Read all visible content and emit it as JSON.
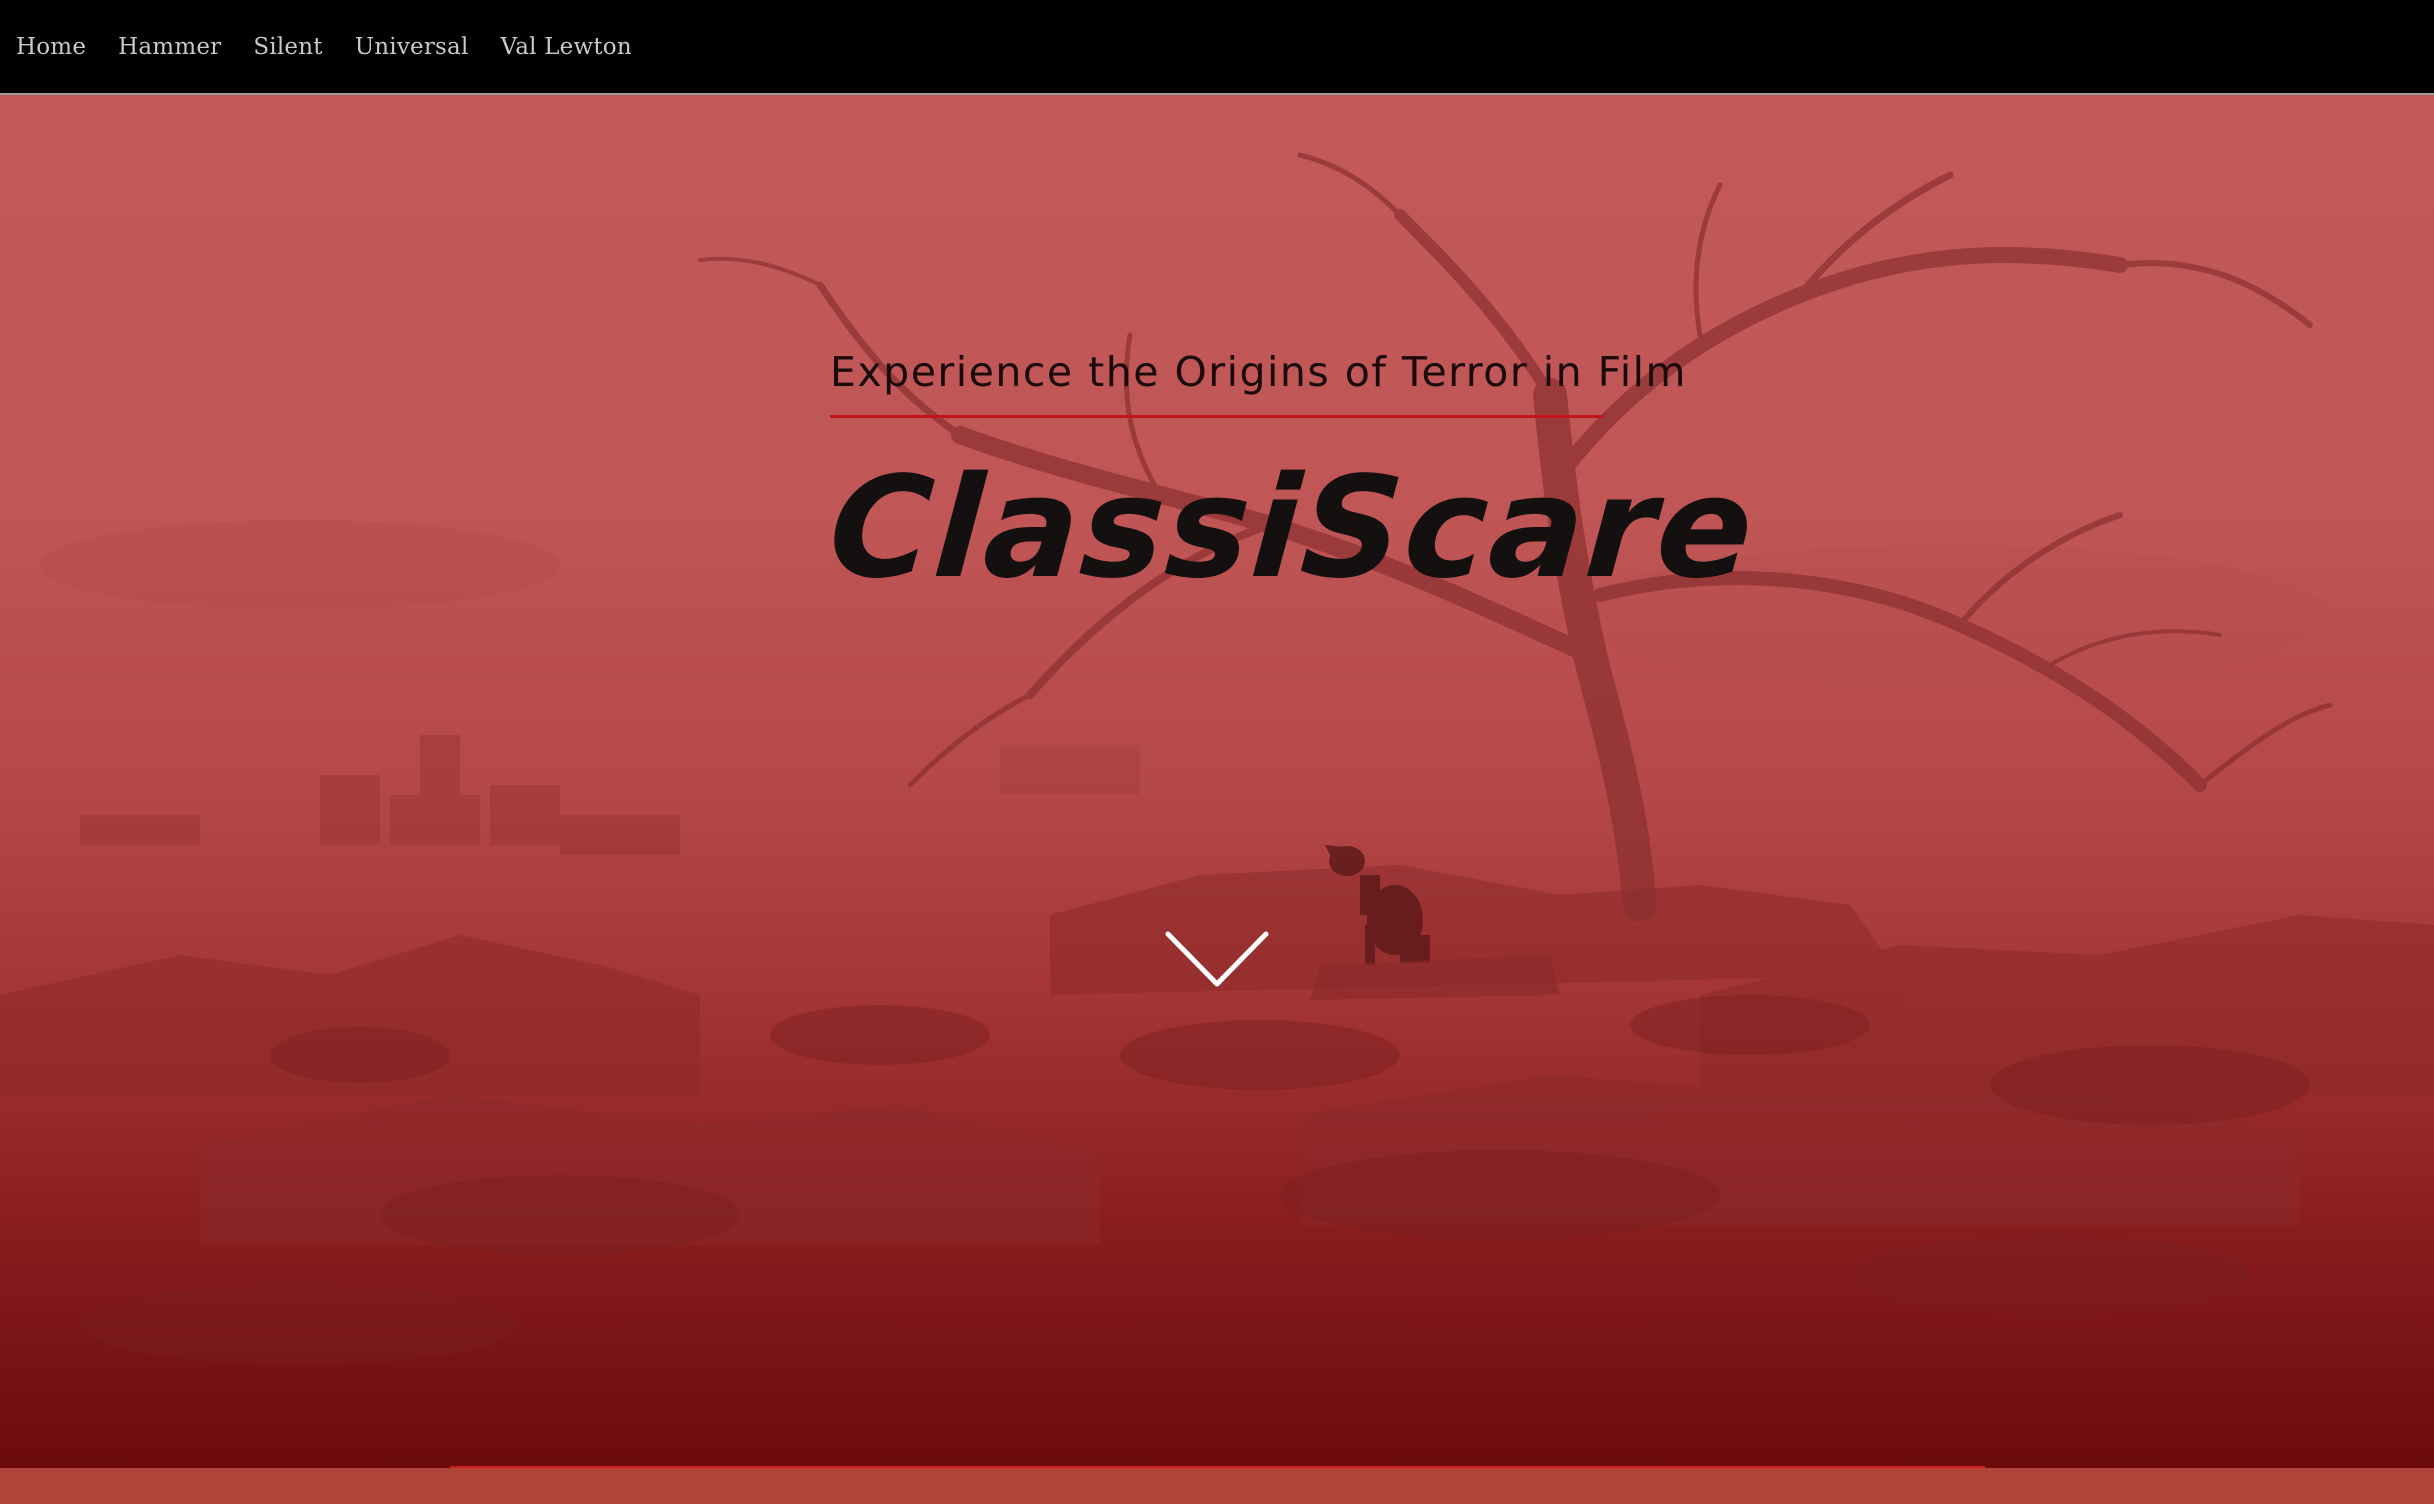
{
  "nav": {
    "items": [
      {
        "label": "Home"
      },
      {
        "label": "Hammer"
      },
      {
        "label": "Silent"
      },
      {
        "label": "Universal"
      },
      {
        "label": "Val Lewton"
      }
    ]
  },
  "hero": {
    "subtitle": "Experience the Origins of Terror in Film",
    "title": "ClassiScare",
    "scroll_icon": "chevron-down-icon",
    "background_image": "foggy-tree-with-dog-silhouette"
  },
  "colors": {
    "nav_bg": "#000000",
    "nav_text": "#c9c9c9",
    "hero_top": "#c25959",
    "hero_bottom": "#6b0a0d",
    "accent_red": "#c4141a",
    "title_text": "#151010",
    "footer_strip": "#b04439"
  }
}
